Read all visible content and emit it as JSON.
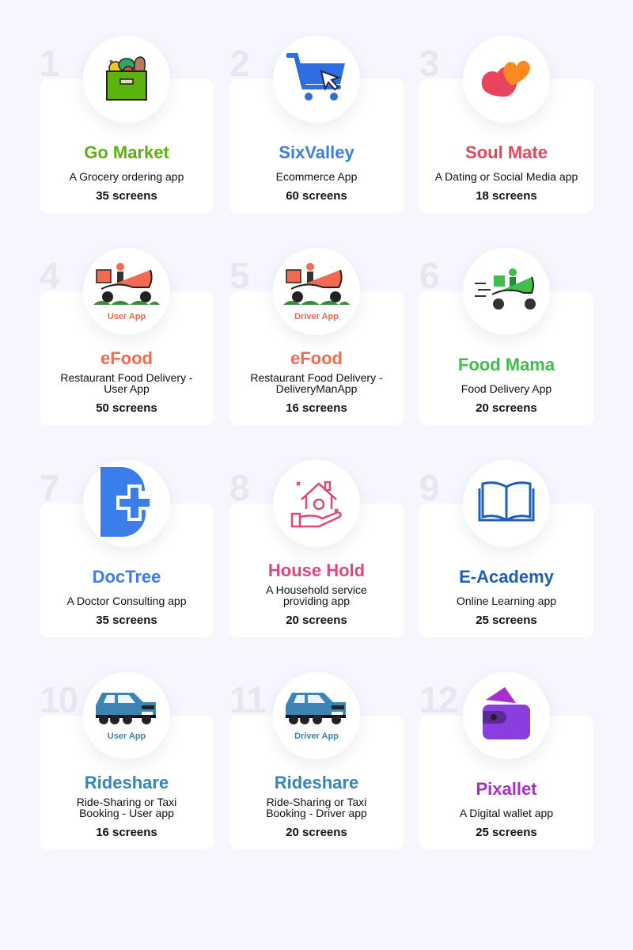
{
  "apps": [
    {
      "num": "1",
      "title": "Go Market",
      "desc": "A Grocery ordering app",
      "screens": "35 screens",
      "color": "#5cb30e",
      "icon": "grocery-bag-icon"
    },
    {
      "num": "2",
      "title": "SixValley",
      "desc": "Ecommerce App",
      "screens": "60 screens",
      "color": "#3b7de9",
      "icon": "shopping-cart-icon"
    },
    {
      "num": "3",
      "title": "Soul Mate",
      "desc": "A Dating or Social Media app",
      "screens": "18 screens",
      "color": "#e8445e",
      "icon": "hearts-icon"
    },
    {
      "num": "4",
      "title": "eFood",
      "desc": "Restaurant Food Delivery - User App",
      "screens": "50 screens",
      "color": "#f26a4f",
      "icon": "delivery-scooter-icon",
      "badge": "User App"
    },
    {
      "num": "5",
      "title": "eFood",
      "desc": "Restaurant Food Delivery - DeliveryManApp",
      "screens": "16 screens",
      "color": "#f26a4f",
      "icon": "delivery-scooter-icon",
      "badge": "Driver App"
    },
    {
      "num": "6",
      "title": "Food Mama",
      "desc": "Food Delivery App",
      "screens": "20 screens",
      "color": "#3fbf4a",
      "icon": "green-scooter-icon"
    },
    {
      "num": "7",
      "title": "DocTree",
      "desc": "A Doctor Consulting app",
      "screens": "35 screens",
      "color": "#3b7de9",
      "icon": "medical-cross-icon"
    },
    {
      "num": "8",
      "title": "House Hold",
      "desc": "A Household service providing app",
      "screens": "20 screens",
      "color": "#e0457b",
      "icon": "house-hand-icon"
    },
    {
      "num": "9",
      "title": "E-Academy",
      "desc": "Online Learning app",
      "screens": "25 screens",
      "color": "#1f5fb5",
      "icon": "open-book-icon"
    },
    {
      "num": "10",
      "title": "Rideshare",
      "desc": "Ride-Sharing or Taxi Booking - User app",
      "screens": "16 screens",
      "color": "#3a85b5",
      "icon": "car-icon",
      "badge": "User App"
    },
    {
      "num": "11",
      "title": "Rideshare",
      "desc": "Ride-Sharing or Taxi Booking - Driver app",
      "screens": "20 screens",
      "color": "#3a85b5",
      "icon": "car-icon",
      "badge": "Driver App"
    },
    {
      "num": "12",
      "title": "Pixallet",
      "desc": "A Digital wallet app",
      "screens": "25 screens",
      "color": "#a82fc9",
      "icon": "wallet-icon"
    }
  ]
}
